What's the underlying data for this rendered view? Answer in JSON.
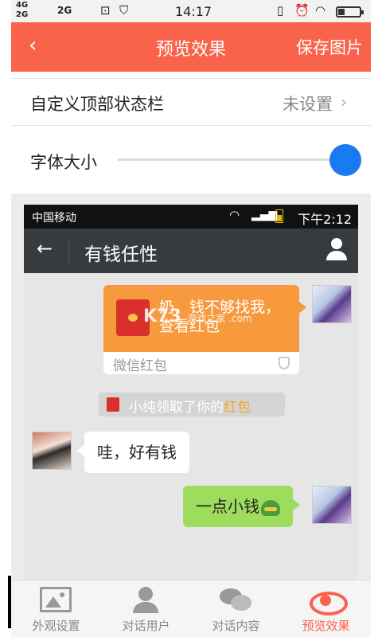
{
  "status_bar": {
    "network_1": "4G",
    "network_2": "2G",
    "network_3": "2G",
    "time": "14:17"
  },
  "header": {
    "back_icon": "back-arrow-icon",
    "title": "预览效果",
    "save_label": "保存图片"
  },
  "settings": {
    "status_bar_row": {
      "label": "自定义顶部状态栏",
      "value": "未设置"
    },
    "font_size_row": {
      "label": "字体大小",
      "slider_position": 1.0
    }
  },
  "preview": {
    "status_bar": {
      "carrier": "中国移动",
      "time": "下午2:12"
    },
    "nav": {
      "title": "有钱任性"
    },
    "red_packet": {
      "message": "奶，钱不够找我，查看红包",
      "footer": "微信红包"
    },
    "system_message": {
      "text": "小纯领取了你的",
      "highlight": "红包"
    },
    "incoming_message": "哇，好有钱",
    "outgoing_message": "一点小钱",
    "watermark": {
      "main": "K73",
      "sub": "游戏之家 .com"
    }
  },
  "tabs": [
    {
      "label": "外观设置",
      "icon": "image-icon",
      "active": false
    },
    {
      "label": "对话用户",
      "icon": "user-icon",
      "active": false
    },
    {
      "label": "对话内容",
      "icon": "chat-icon",
      "active": false
    },
    {
      "label": "预览效果",
      "icon": "eye-icon",
      "active": true
    }
  ],
  "colors": {
    "accent": "#f9624b",
    "slider_knob": "#1a7af0",
    "red_packet": "#f79a3e",
    "sent_bubble": "#9ddc5c"
  }
}
